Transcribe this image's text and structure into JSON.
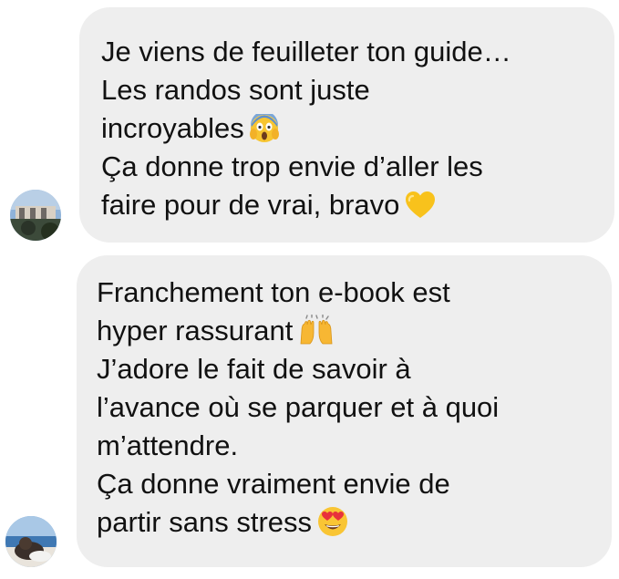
{
  "messages": [
    {
      "avatar_icon": "user-avatar-photo",
      "lines": [
        "Je viens de feuilleter ton guide…",
        "Les randos sont juste",
        "incroyables",
        "Ça donne trop envie d’aller les",
        "faire pour de vrai, bravo"
      ],
      "emojis": [
        "face-screaming-in-fear-emoji",
        "yellow-heart-emoji"
      ]
    },
    {
      "avatar_icon": "user-avatar-photo",
      "lines": [
        "Franchement ton e-book est",
        "hyper rassurant",
        "J’adore le fait de savoir à",
        "l’avance où se parquer et à quoi",
        "m’attendre.",
        "Ça donne vraiment envie de",
        "partir sans stress"
      ],
      "emojis": [
        "raising-hands-emoji",
        "heart-eyes-emoji"
      ]
    }
  ],
  "colors": {
    "bubble_background": "#eeeeee",
    "text": "#111111",
    "page_background": "#ffffff"
  }
}
